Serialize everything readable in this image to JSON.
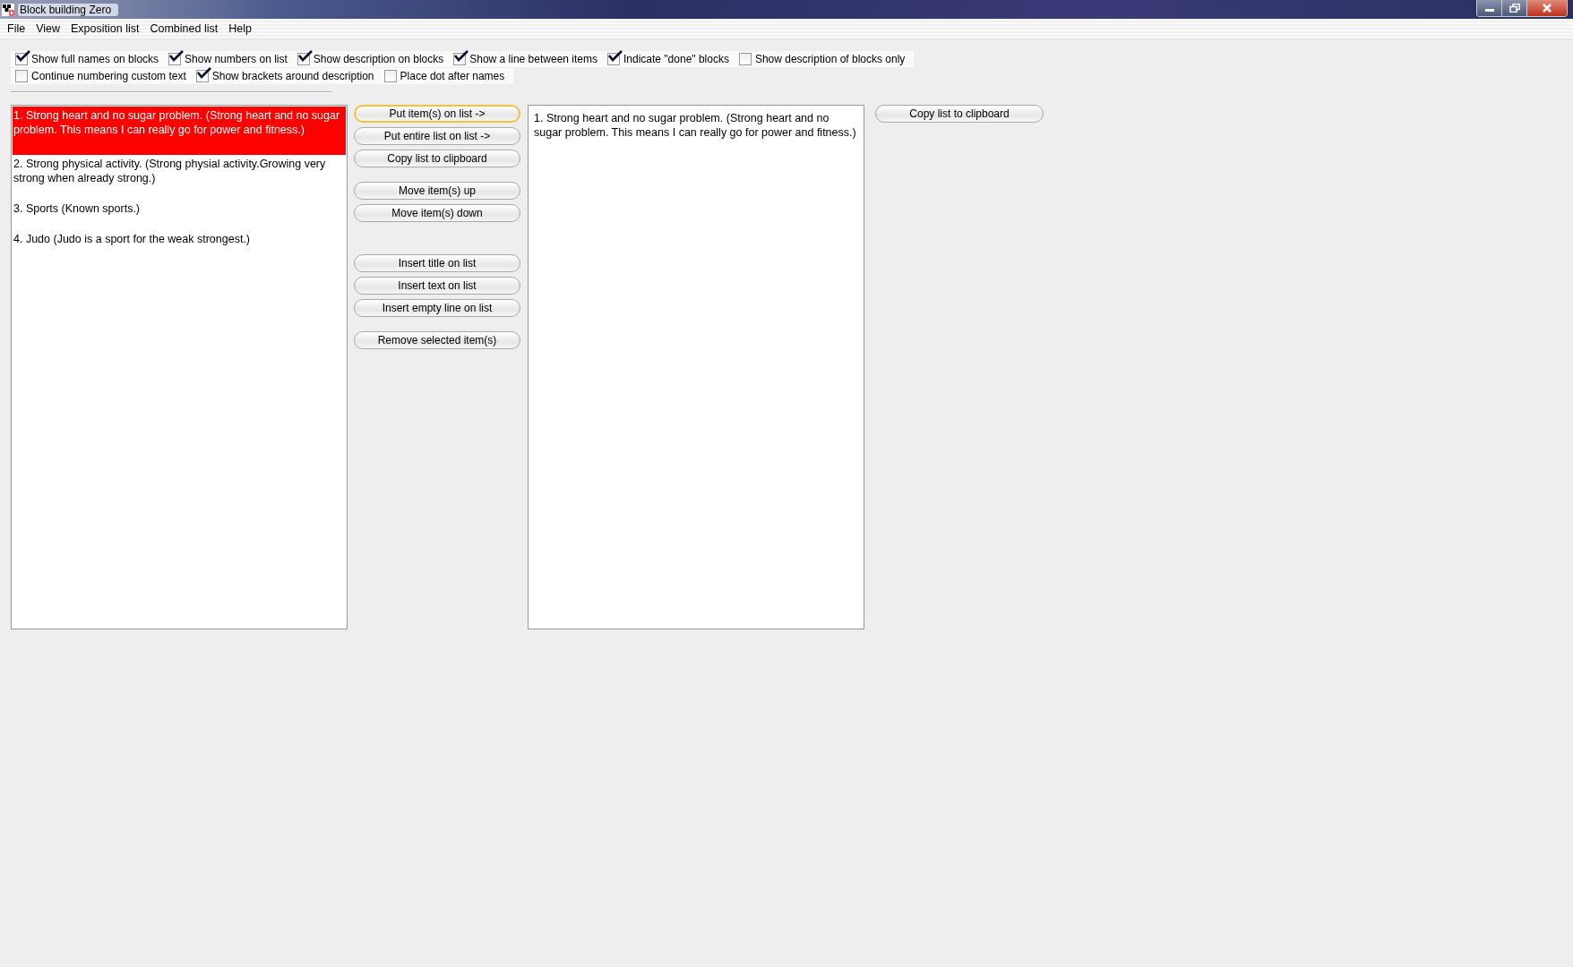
{
  "window": {
    "title": "Block building Zero"
  },
  "menu": [
    "File",
    "View",
    "Exposition list",
    "Combined list",
    "Help"
  ],
  "option_rows": [
    [
      {
        "label": "Show full names on blocks",
        "checked": true
      },
      {
        "label": "Show numbers on list",
        "checked": true
      },
      {
        "label": "Show description on blocks",
        "checked": true
      },
      {
        "label": "Show a line between items",
        "checked": true
      },
      {
        "label": "Indicate \"done\" blocks",
        "checked": true
      },
      {
        "label": "Show description of blocks only",
        "checked": false
      }
    ],
    [
      {
        "label": "Continue numbering custom text",
        "checked": false
      },
      {
        "label": "Show brackets around description",
        "checked": true
      },
      {
        "label": "Place dot after names",
        "checked": false
      }
    ]
  ],
  "exposition_list": [
    {
      "text": "1. Strong heart and no sugar problem. (Strong heart and no sugar problem. This means I can really go for power and fitness.)",
      "selected": true
    },
    {
      "text": "2. Strong physical activity. (Strong physial activity.Growing very strong when already strong.)",
      "selected": false
    },
    {
      "text": "3. Sports (Known sports.)",
      "selected": false
    },
    {
      "text": "4. Judo (Judo is a sport for the weak strongest.)",
      "selected": false
    }
  ],
  "button_groups": [
    [
      {
        "label": "Put item(s) on list ->",
        "focused": true
      },
      {
        "label": "Put entire list on list ->",
        "focused": false
      },
      {
        "label": "Copy list to clipboard",
        "focused": false
      }
    ],
    [
      {
        "label": "Move item(s) up",
        "focused": false
      },
      {
        "label": "Move item(s) down",
        "focused": false
      }
    ],
    [
      {
        "label": "Insert title on list",
        "focused": false
      },
      {
        "label": "Insert text on list",
        "focused": false
      },
      {
        "label": "Insert empty line on list",
        "focused": false
      }
    ],
    [
      {
        "label": "Remove selected item(s)",
        "focused": false
      }
    ]
  ],
  "combined_list": [
    "1. Strong heart and no sugar problem. (Strong heart and no sugar problem. This means I can really go for power and fitness.)"
  ],
  "combined_button": "Copy list to clipboard"
}
